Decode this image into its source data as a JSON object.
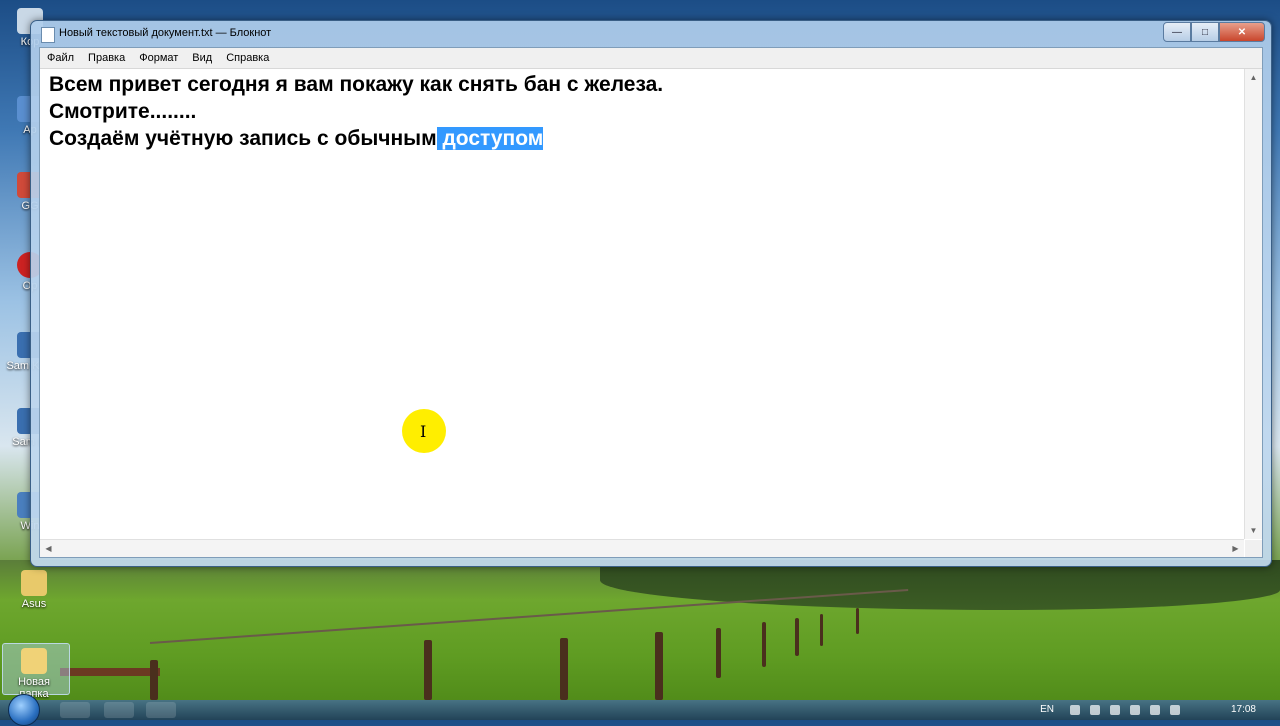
{
  "window": {
    "title": "Новый текстовый документ.txt — Блокнот",
    "buttons": {
      "minimize": "—",
      "maximize": "□",
      "close": "✕"
    }
  },
  "menu": {
    "items": [
      {
        "label": "Файл"
      },
      {
        "label": "Правка"
      },
      {
        "label": "Формат"
      },
      {
        "label": "Вид"
      },
      {
        "label": "Справка"
      }
    ]
  },
  "editor": {
    "line1": "Всем привет сегодня я вам покажу как снять бан с железа.",
    "line2": "Смотрите........",
    "line3_plain": "Создаём учётную запись с обычным",
    "line3_selected": " доступом"
  },
  "desktop": {
    "icons": [
      {
        "label": "Кор"
      },
      {
        "label": "Ap"
      },
      {
        "label": "GG"
      },
      {
        "label": "Op"
      },
      {
        "label": "Sam Kies"
      },
      {
        "label": "Sam Ki"
      },
      {
        "label": "Win"
      },
      {
        "label": "Asus"
      },
      {
        "label": "Новая папка"
      }
    ]
  },
  "taskbar": {
    "language": "EN",
    "clock": "17:08"
  },
  "colors": {
    "selection": "#3399ff",
    "cursor_highlight": "#ffee00"
  }
}
